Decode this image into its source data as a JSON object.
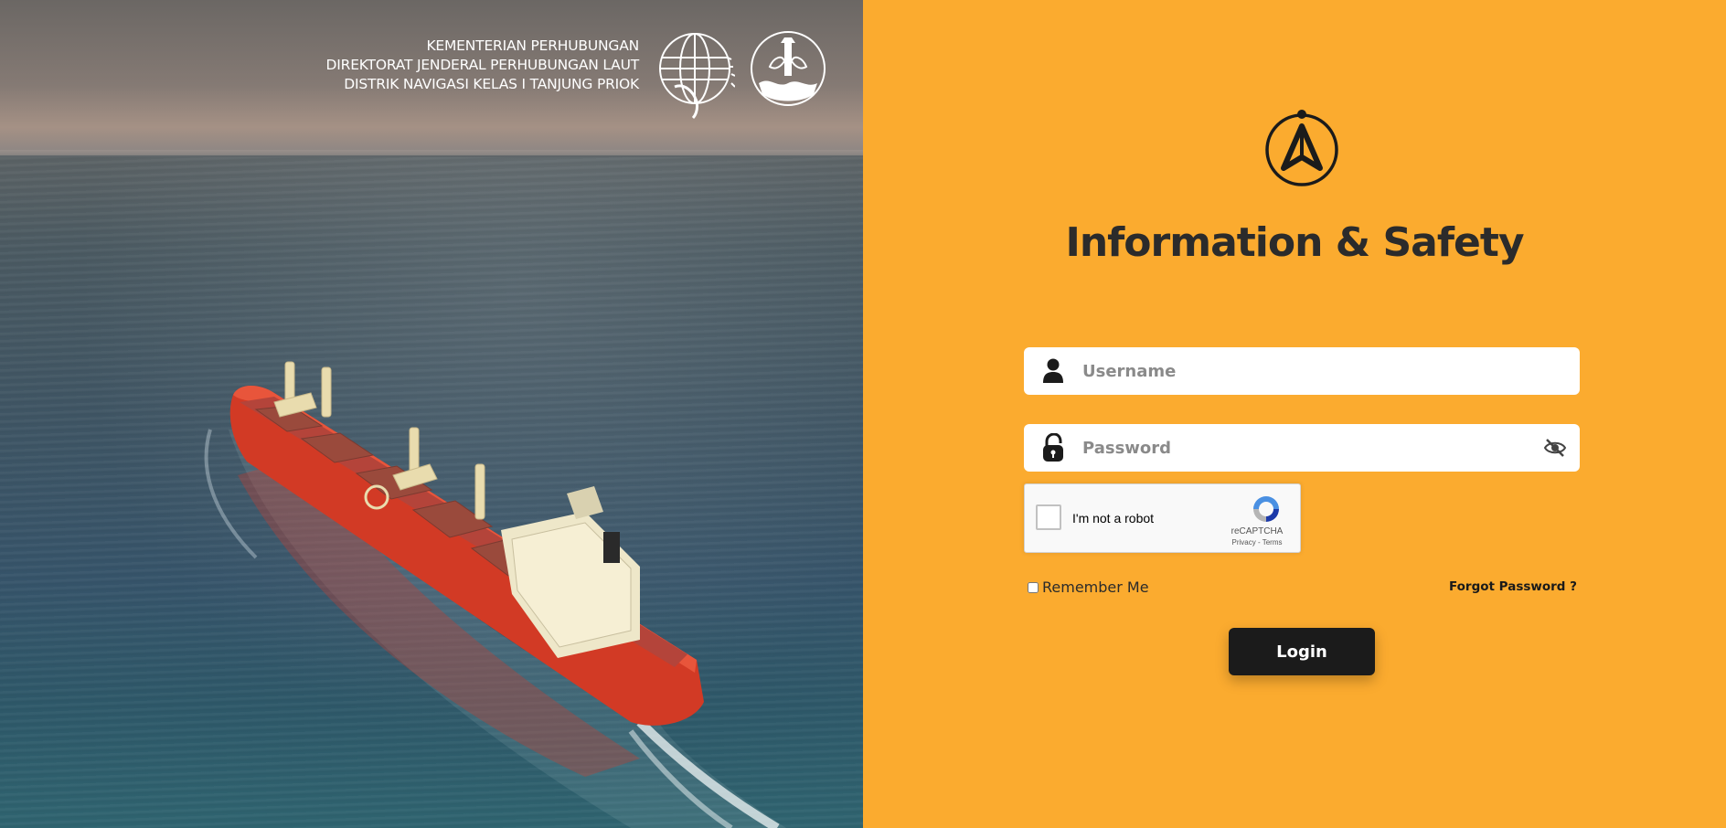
{
  "header": {
    "ministry_lines": [
      "KEMENTERIAN PERHUBUNGAN",
      "DIREKTORAT JENDERAL PERHUBUNGAN LAUT",
      "DISTRIK NAVIGASI KELAS I TANJUNG PRIOK"
    ],
    "emblems": [
      "ministry-globe-emblem-icon",
      "navigation-lighthouse-emblem-icon"
    ]
  },
  "login": {
    "app_logo_icon": "compass-arrow-logo-icon",
    "title": "Information & Safety",
    "username": {
      "placeholder": "Username",
      "value": "",
      "icon": "user-icon"
    },
    "password": {
      "placeholder": "Password",
      "value": "",
      "icon": "lock-icon",
      "toggle_icon": "eye-slash-icon"
    },
    "recaptcha": {
      "label": "I'm not a robot",
      "brand": "reCAPTCHA",
      "links": "Privacy - Terms"
    },
    "remember_label": "Remember Me",
    "forgot_label": "Forgot Password ?",
    "submit_label": "Login"
  },
  "colors": {
    "panel_background": "#fbab2f",
    "title_text": "#2b2b2b",
    "button_background": "#1b1b1b",
    "button_text": "#ffffff"
  }
}
